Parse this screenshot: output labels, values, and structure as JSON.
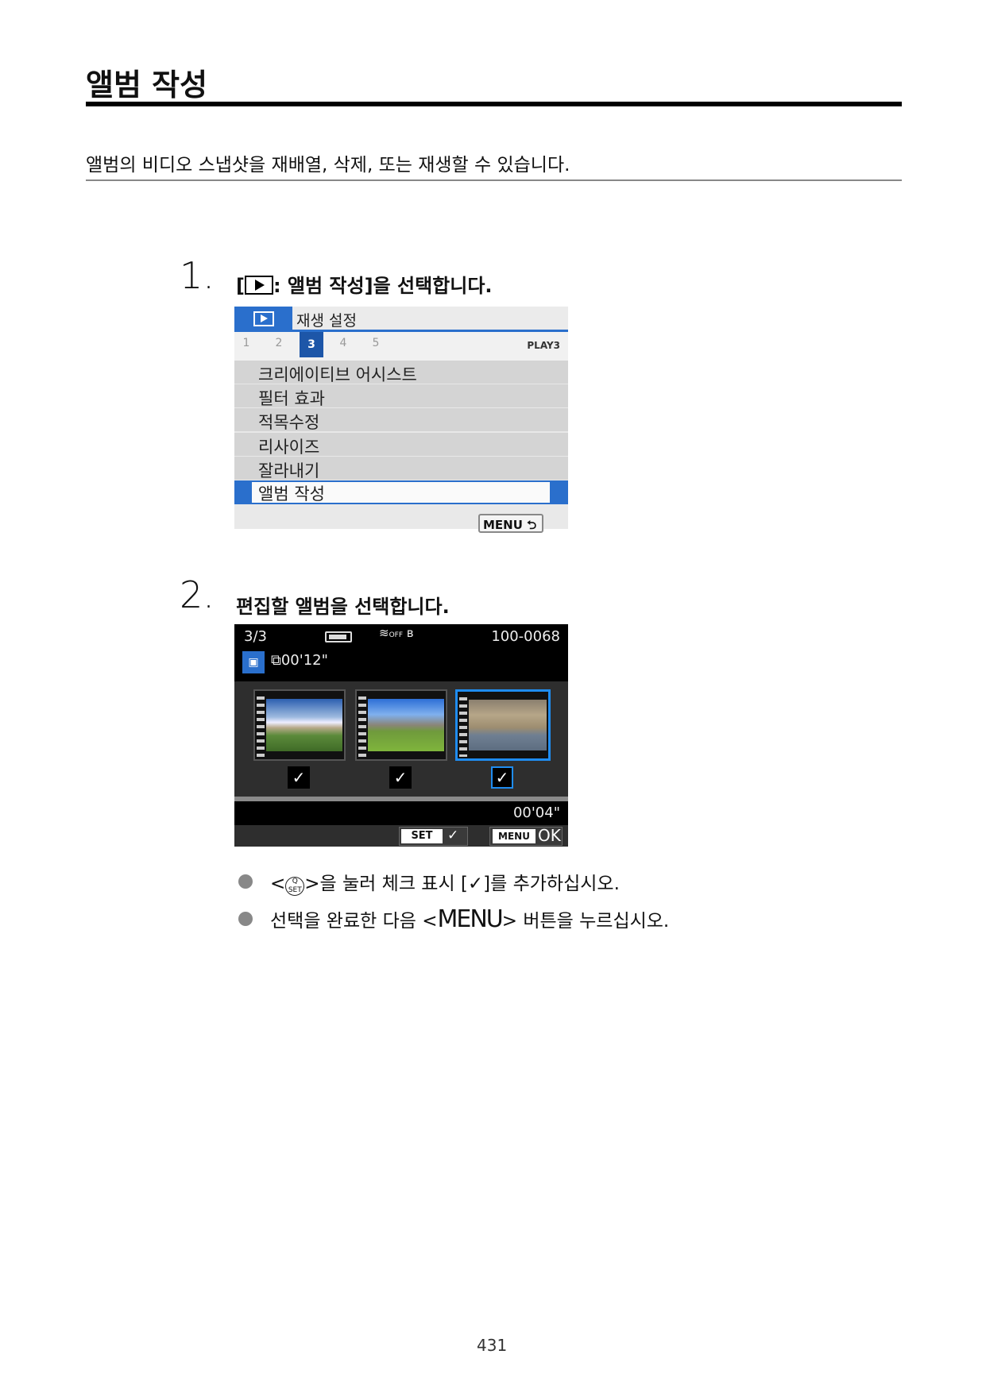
{
  "title": "앨범 작성",
  "intro": "앨범의 비디오 스냅샷을 재배열, 삭제, 또는 재생할 수 있습니다.",
  "steps": [
    {
      "number": "1.",
      "text_pre": "[",
      "text_post": ": 앨범 작성]을 선택합니다."
    },
    {
      "number": "2.",
      "text": "편집할 앨범을 선택합니다."
    }
  ],
  "screen1": {
    "header_title": "재생 설정",
    "tabs": [
      "1",
      "2",
      "3",
      "4",
      "5"
    ],
    "selected_tab": "3",
    "tab_label": "PLAY3",
    "items": [
      "크리에이티브 어시스트",
      "필터 효과",
      "적목수정",
      "리사이즈",
      "잘라내기",
      "앨범 작성"
    ],
    "selected_item": "앨범 작성",
    "menu_button": "MENU ⮌"
  },
  "screen2": {
    "index": "3/3",
    "wifi": "OFF",
    "file_number": "100-0068",
    "album_length": "00'12\"",
    "clip_length": "00'04\"",
    "thumbnails": [
      {
        "checked": true,
        "selected": false
      },
      {
        "checked": true,
        "selected": false
      },
      {
        "checked": true,
        "selected": true
      }
    ],
    "check_mark": "✓",
    "set_label": "SET",
    "menu_label": "MENU",
    "ok_label": "OK"
  },
  "bullets": [
    {
      "pre": "<",
      "icon_top": "Q",
      "icon_bottom": "SET",
      "post": ">을 눌러 체크 표시 [✓]를 추가하십시오."
    },
    {
      "pre": "선택을 완료한 다음 <",
      "menu": "MENU",
      "post": "> 버튼을 누르십시오."
    }
  ],
  "page_number": "431",
  "colors": {
    "accent_blue": "#2a6fcc",
    "select_blue": "#1f8cf0"
  }
}
